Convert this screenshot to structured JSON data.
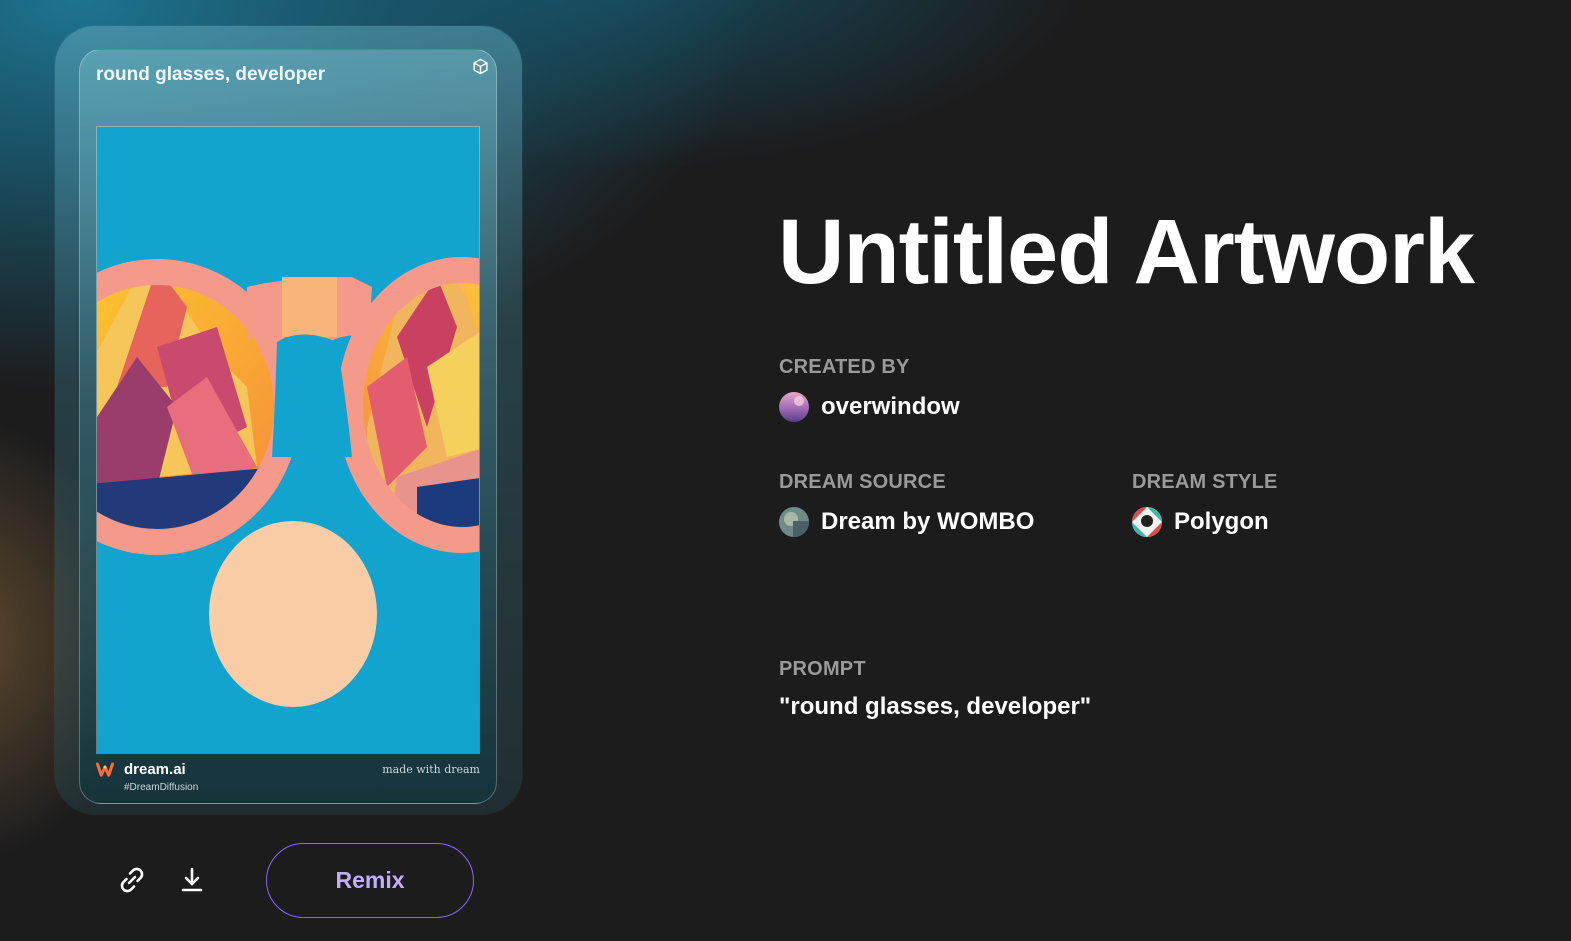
{
  "card": {
    "title": "round glasses, developer",
    "footer_brand": "dream.ai",
    "footer_tag": "#DreamDiffusion",
    "footer_made": "made with dream"
  },
  "actions": {
    "link_icon": "link-icon",
    "download_icon": "download-icon",
    "remix_label": "Remix"
  },
  "artwork": {
    "title": "Untitled Artwork",
    "created_by_label": "CREATED BY",
    "creator": "overwindow",
    "dream_source_label": "DREAM SOURCE",
    "dream_source": "Dream by WOMBO",
    "dream_style_label": "DREAM STYLE",
    "dream_style": "Polygon",
    "prompt_label": "PROMPT",
    "prompt": "\"round glasses, developer\""
  },
  "colors": {
    "background": "#1c1c1d",
    "remix_border": "#8a66ff",
    "remix_text": "#c3adff",
    "label": "#9a9a9c",
    "art_sky": "#12a3cf"
  }
}
